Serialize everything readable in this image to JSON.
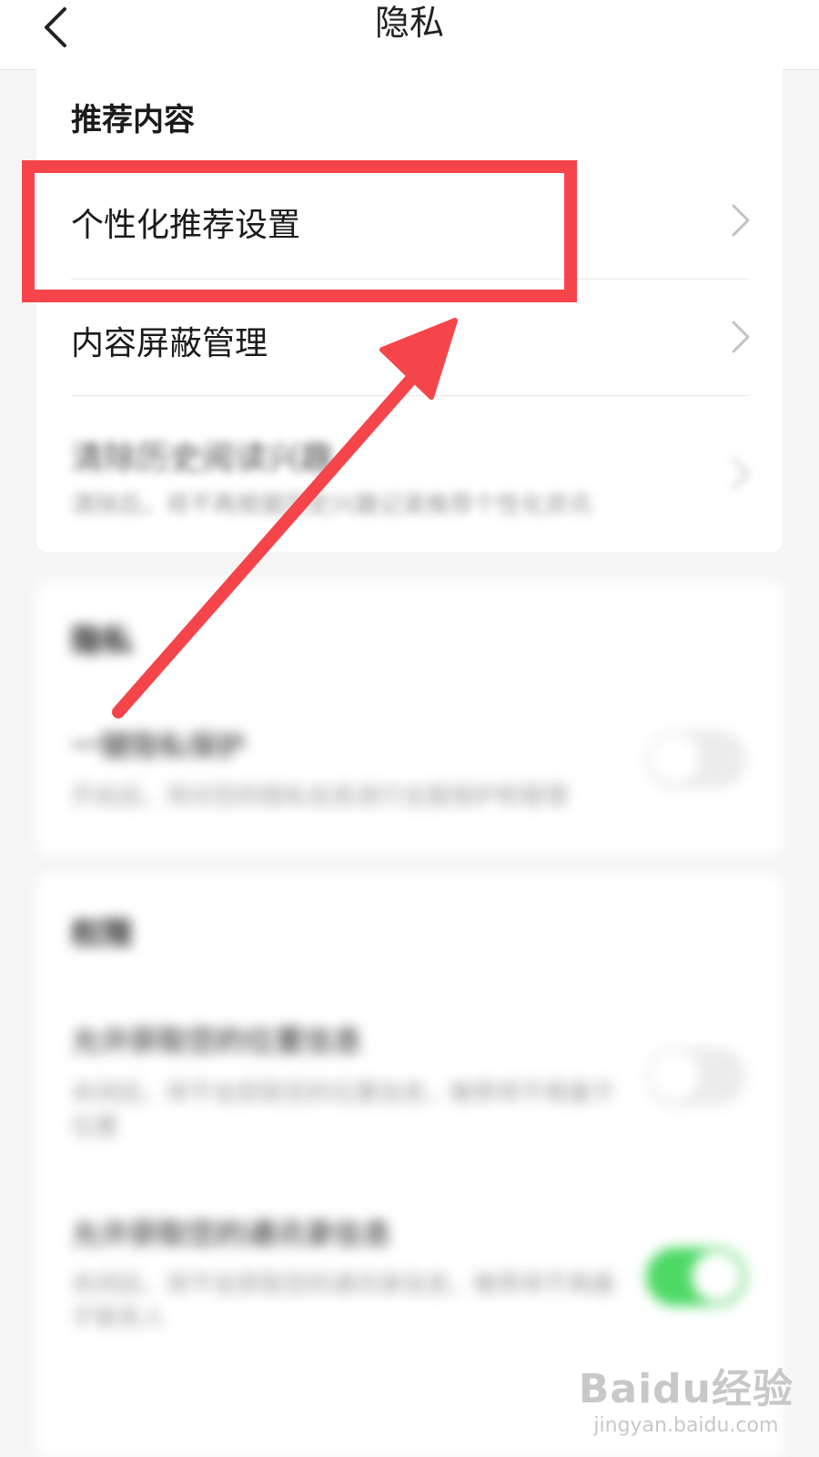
{
  "header": {
    "title": "隐私"
  },
  "recommend": {
    "section_title": "推荐内容",
    "items": [
      {
        "label": "个性化推荐设置"
      },
      {
        "label": "内容屏蔽管理"
      },
      {
        "label": "清除历史阅读兴趣",
        "sub": "清除后，将不再根据历史兴趣记录推荐个性化资讯"
      }
    ]
  },
  "section2": {
    "title": "隐私",
    "item": {
      "label": "一键隐私保护",
      "sub": "开启后，将对您的隐私信息进行全面保护和管理",
      "toggle_on": false
    }
  },
  "section3": {
    "title": "权限",
    "items": [
      {
        "label": "允许获取您的位置信息",
        "sub": "关闭后，将不会获取您的位置信息，推荐将不再基于位置",
        "toggle_on": false
      },
      {
        "label": "允许获取您的通讯录信息",
        "sub": "关闭后，将不会获取您的通讯录信息，推荐将不再基于联系人",
        "toggle_on": true
      }
    ]
  },
  "watermark": {
    "logo": "Baidu经验",
    "url": "jingyan.baidu.com"
  },
  "colors": {
    "annotation": "#f5454a",
    "toggle_on": "#4cd964"
  }
}
